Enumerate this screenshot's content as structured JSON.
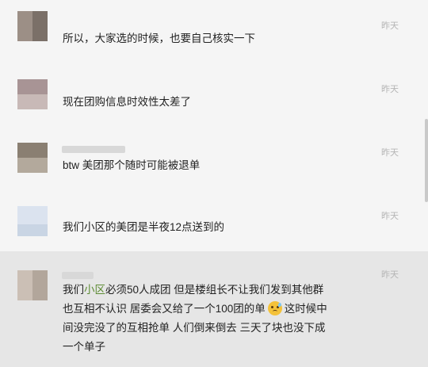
{
  "messages": [
    {
      "time": "昨天",
      "text": "所以，大家选的时候，也要自己核实一下"
    },
    {
      "time": "昨天",
      "text": "现在团购信息时效性太差了"
    },
    {
      "time": "昨天",
      "text": "btw 美团那个随时可能被退单"
    },
    {
      "time": "昨天",
      "text": "我们小区的美团是半夜12点送到的"
    },
    {
      "time": "昨天",
      "text_parts": {
        "prefix": "我们",
        "highlight": "小区",
        "line1_rest": "必须50人成团 但是楼组长不让我们发到其他群",
        "line2_a": "也互相不认识 居委会又给了一个100团的单",
        "line2_b": "这时候中",
        "line3": "间没完没了的互相抢单 人们倒来倒去 三天了块也没下成",
        "line4": "一个单子"
      },
      "emoji": "sweat-smile-emoji"
    }
  ],
  "colors": {
    "highlight": "#5d8c34",
    "time": "#b5b5b5",
    "text": "#222222",
    "background": "#f5f5f5",
    "selected_row": "#e6e6e6"
  }
}
